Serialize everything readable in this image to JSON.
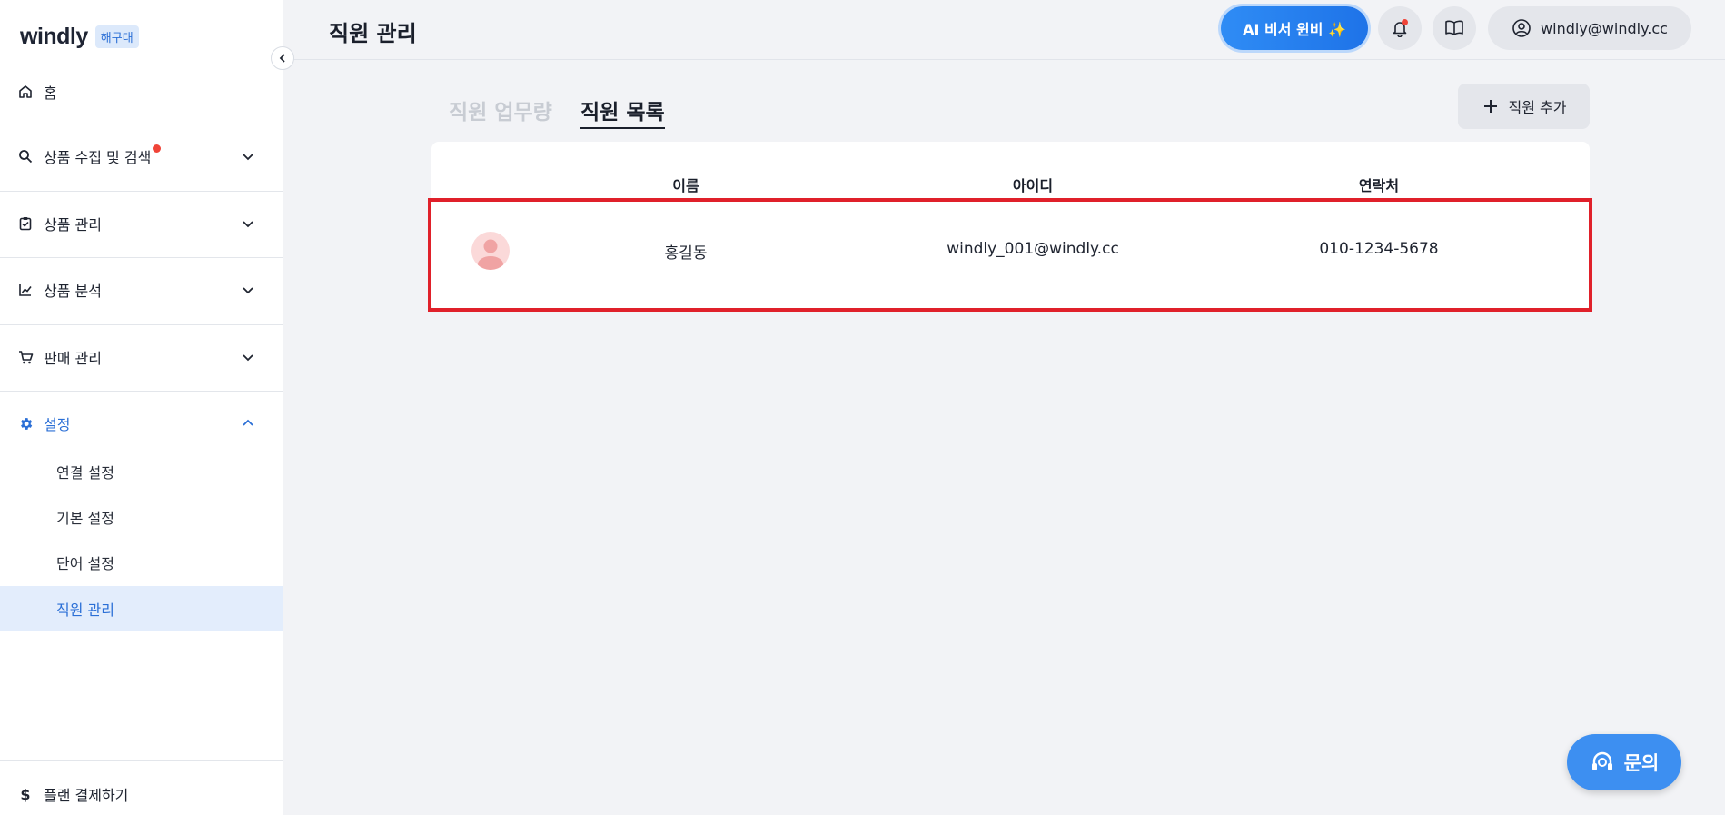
{
  "sidebar": {
    "logo": "windly",
    "badge": "해구대",
    "home": "홈",
    "items": [
      {
        "label": "상품 수집 및 검색"
      },
      {
        "label": "상품 관리"
      },
      {
        "label": "상품 분석"
      },
      {
        "label": "판매 관리"
      },
      {
        "label": "설정"
      }
    ],
    "sub_items": [
      {
        "label": "연결 설정"
      },
      {
        "label": "기본 설정"
      },
      {
        "label": "단어 설정"
      },
      {
        "label": "직원 관리"
      }
    ],
    "footer": "플랜 결제하기"
  },
  "header": {
    "title": "직원 관리",
    "ai_button": "AI 비서 윈비 ✨",
    "user_email": "windly@windly.cc"
  },
  "tabs": [
    {
      "label": "직원 업무량"
    },
    {
      "label": "직원 목록"
    }
  ],
  "add_button": "직원 추가",
  "table": {
    "columns": [
      "이름",
      "아이디",
      "연락처"
    ],
    "rows": [
      {
        "name": "홍길동",
        "id": "windly_001@windly.cc",
        "phone": "010-1234-5678"
      }
    ]
  },
  "contact_button": "문의",
  "colors": {
    "accent": "#2b6fd6",
    "highlight_border": "#e0202a"
  }
}
